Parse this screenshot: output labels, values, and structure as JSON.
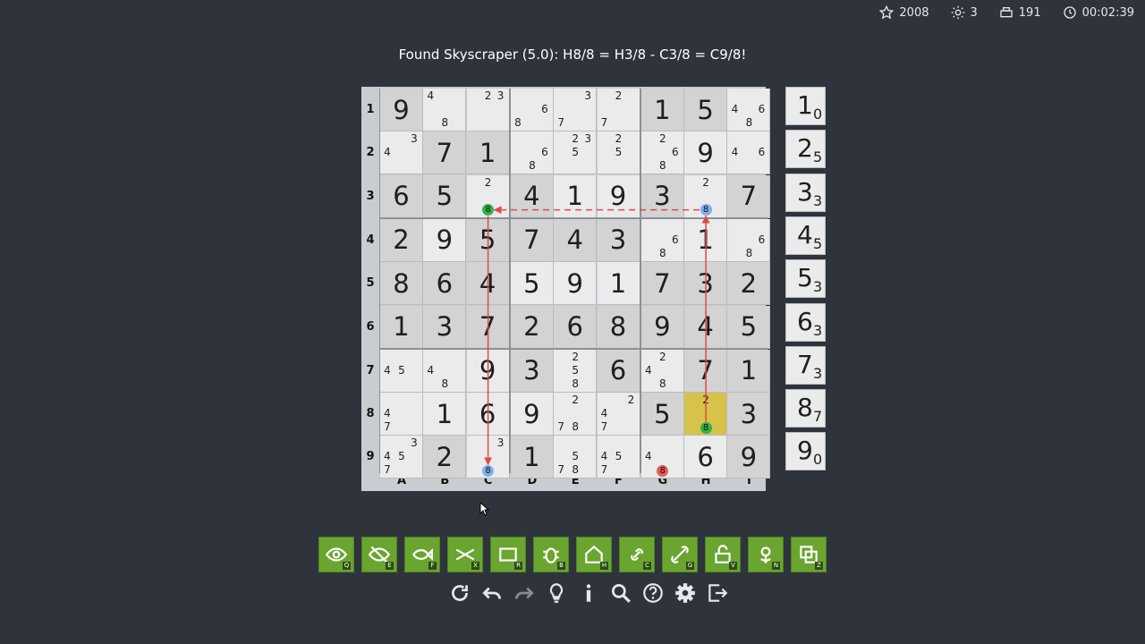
{
  "stats": {
    "stars": "2008",
    "hints": "3",
    "prints": "191",
    "timer": "00:02:39"
  },
  "message": "Found Skyscraper (5.0): H8/8 = H3/8 - C3/8 = C9/8!",
  "row_labels": [
    "1",
    "2",
    "3",
    "4",
    "5",
    "6",
    "7",
    "8",
    "9"
  ],
  "col_labels": [
    "A",
    "B",
    "C",
    "D",
    "E",
    "F",
    "G",
    "H",
    "I"
  ],
  "grid": [
    [
      {
        "v": "9",
        "given": true
      },
      {
        "c": [
          "4",
          "8"
        ],
        "pos": [
          0,
          7
        ]
      },
      {
        "c": [
          "2",
          "3"
        ],
        "pos": [
          1,
          2
        ]
      },
      {
        "c": [
          "6",
          "8"
        ],
        "pos": [
          5,
          6
        ]
      },
      {
        "c": [
          "3",
          "7"
        ],
        "pos": [
          2,
          6
        ]
      },
      {
        "c": [
          "2",
          "7"
        ],
        "pos": [
          1,
          6
        ]
      },
      {
        "v": "1",
        "given": true
      },
      {
        "v": "5",
        "given": true
      },
      {
        "c": [
          "4",
          "6",
          "8"
        ],
        "pos": [
          3,
          5,
          7
        ]
      }
    ],
    [
      {
        "c": [
          "4",
          "3"
        ],
        "pos": [
          3,
          2
        ]
      },
      {
        "v": "7",
        "given": true
      },
      {
        "v": "1",
        "given": true
      },
      {
        "c": [
          "6",
          "8"
        ],
        "pos": [
          5,
          7
        ]
      },
      {
        "c": [
          "2",
          "3",
          "5"
        ],
        "pos": [
          1,
          2,
          4
        ]
      },
      {
        "c": [
          "2",
          "5"
        ],
        "pos": [
          1,
          4
        ]
      },
      {
        "c": [
          "2",
          "6",
          "8"
        ],
        "pos": [
          1,
          5,
          7
        ]
      },
      {
        "v": "9",
        "given": false
      },
      {
        "c": [
          "4",
          "6"
        ],
        "pos": [
          3,
          5
        ]
      }
    ],
    [
      {
        "v": "6",
        "given": true
      },
      {
        "v": "5",
        "given": true
      },
      {
        "c": [
          "2",
          "8"
        ],
        "pos": [
          1,
          7
        ]
      },
      {
        "v": "4",
        "given": true
      },
      {
        "v": "1",
        "given": false
      },
      {
        "v": "9",
        "given": false
      },
      {
        "v": "3",
        "given": true
      },
      {
        "c": [
          "2",
          "8"
        ],
        "pos": [
          1,
          7
        ]
      },
      {
        "v": "7",
        "given": true
      }
    ],
    [
      {
        "v": "2",
        "given": true
      },
      {
        "v": "9",
        "given": false
      },
      {
        "v": "5",
        "given": true
      },
      {
        "v": "7",
        "given": true
      },
      {
        "v": "4",
        "given": true
      },
      {
        "v": "3",
        "given": true
      },
      {
        "c": [
          "6",
          "8"
        ],
        "pos": [
          5,
          7
        ]
      },
      {
        "v": "1",
        "given": false
      },
      {
        "c": [
          "6",
          "8"
        ],
        "pos": [
          5,
          7
        ]
      }
    ],
    [
      {
        "v": "8",
        "given": true
      },
      {
        "v": "6",
        "given": true
      },
      {
        "v": "4",
        "given": true
      },
      {
        "v": "5",
        "given": false
      },
      {
        "v": "9",
        "given": false
      },
      {
        "v": "1",
        "given": false
      },
      {
        "v": "7",
        "given": true
      },
      {
        "v": "3",
        "given": true
      },
      {
        "v": "2",
        "given": true
      }
    ],
    [
      {
        "v": "1",
        "given": true
      },
      {
        "v": "3",
        "given": true
      },
      {
        "v": "7",
        "given": true
      },
      {
        "v": "2",
        "given": true
      },
      {
        "v": "6",
        "given": true
      },
      {
        "v": "8",
        "given": true
      },
      {
        "v": "9",
        "given": true
      },
      {
        "v": "4",
        "given": true
      },
      {
        "v": "5",
        "given": true
      }
    ],
    [
      {
        "c": [
          "4",
          "5"
        ],
        "pos": [
          3,
          4
        ]
      },
      {
        "c": [
          "4",
          "8"
        ],
        "pos": [
          3,
          7
        ]
      },
      {
        "v": "9",
        "given": false
      },
      {
        "v": "3",
        "given": true
      },
      {
        "c": [
          "2",
          "5",
          "8"
        ],
        "pos": [
          1,
          4,
          7
        ]
      },
      {
        "v": "6",
        "given": true
      },
      {
        "c": [
          "2",
          "4",
          "8"
        ],
        "pos": [
          1,
          3,
          7
        ]
      },
      {
        "v": "7",
        "given": true
      },
      {
        "v": "1",
        "given": true
      }
    ],
    [
      {
        "c": [
          "4",
          "7"
        ],
        "pos": [
          3,
          6
        ]
      },
      {
        "v": "1",
        "given": false
      },
      {
        "v": "6",
        "given": false
      },
      {
        "v": "9",
        "given": false
      },
      {
        "c": [
          "2",
          "7",
          "8"
        ],
        "pos": [
          1,
          6,
          7
        ]
      },
      {
        "c": [
          "2",
          "4",
          "7"
        ],
        "pos": [
          2,
          3,
          6
        ]
      },
      {
        "v": "5",
        "given": true
      },
      {
        "c": [
          "2",
          "8"
        ],
        "pos": [
          1,
          7
        ],
        "highlight": true
      },
      {
        "v": "3",
        "given": true
      }
    ],
    [
      {
        "c": [
          "3",
          "4",
          "5",
          "7"
        ],
        "pos": [
          2,
          3,
          4,
          6
        ]
      },
      {
        "v": "2",
        "given": true
      },
      {
        "c": [
          "3",
          "8"
        ],
        "pos": [
          2,
          7
        ]
      },
      {
        "v": "1",
        "given": true
      },
      {
        "c": [
          "5",
          "7",
          "8"
        ],
        "pos": [
          4,
          6,
          7
        ]
      },
      {
        "c": [
          "4",
          "5",
          "7"
        ],
        "pos": [
          3,
          4,
          6
        ]
      },
      {
        "c": [
          "4",
          "8"
        ],
        "pos": [
          3,
          7
        ]
      },
      {
        "v": "6",
        "given": false
      },
      {
        "v": "9",
        "given": true
      }
    ]
  ],
  "markers": [
    {
      "name": "marker-c3-8",
      "row": 2,
      "col": 2,
      "pos": 7,
      "digit": "8",
      "color": "green"
    },
    {
      "name": "marker-h3-8",
      "row": 2,
      "col": 7,
      "pos": 7,
      "digit": "8",
      "color": "blue"
    },
    {
      "name": "marker-c9-8",
      "row": 8,
      "col": 2,
      "pos": 7,
      "digit": "8",
      "color": "blue"
    },
    {
      "name": "marker-h8-8",
      "row": 7,
      "col": 7,
      "pos": 7,
      "digit": "8",
      "color": "green"
    },
    {
      "name": "marker-g9-8",
      "row": 8,
      "col": 6,
      "pos": 7,
      "digit": "8",
      "color": "red"
    }
  ],
  "links": [
    {
      "name": "link-h3-c3",
      "from": {
        "row": 2,
        "col": 7
      },
      "to": {
        "row": 2,
        "col": 2
      },
      "style": "dashed"
    },
    {
      "name": "link-c3-c9",
      "from": {
        "row": 2,
        "col": 2
      },
      "to": {
        "row": 8,
        "col": 2
      },
      "style": "solid"
    },
    {
      "name": "link-h8-h3",
      "from": {
        "row": 7,
        "col": 7
      },
      "to": {
        "row": 2,
        "col": 7
      },
      "style": "solid"
    }
  ],
  "number_counts": [
    {
      "digit": "1",
      "count": "0"
    },
    {
      "digit": "2",
      "count": "5"
    },
    {
      "digit": "3",
      "count": "3"
    },
    {
      "digit": "4",
      "count": "5"
    },
    {
      "digit": "5",
      "count": "3"
    },
    {
      "digit": "6",
      "count": "3"
    },
    {
      "digit": "7",
      "count": "3"
    },
    {
      "digit": "8",
      "count": "7"
    },
    {
      "digit": "9",
      "count": "0"
    }
  ],
  "tools": [
    {
      "name": "eye",
      "key": "Q"
    },
    {
      "name": "eye-slash",
      "key": "E"
    },
    {
      "name": "fish",
      "key": "F"
    },
    {
      "name": "x-wing",
      "key": "X"
    },
    {
      "name": "rectangle",
      "key": "R"
    },
    {
      "name": "bug",
      "key": "B"
    },
    {
      "name": "house",
      "key": "H"
    },
    {
      "name": "chain",
      "key": "C"
    },
    {
      "name": "group-chain",
      "key": "G"
    },
    {
      "name": "unlock",
      "key": "V"
    },
    {
      "name": "flower",
      "key": "N"
    },
    {
      "name": "copy",
      "key": "Z"
    }
  ],
  "actions": [
    "restart",
    "undo",
    "redo",
    "hint",
    "info",
    "search",
    "help",
    "settings",
    "exit"
  ],
  "colors": {
    "accent_green": "#6aa52f",
    "highlight": "#d7c24a",
    "link_red": "#e04848",
    "marker_green": "#33b34a",
    "marker_blue": "#7fb0ef",
    "marker_red": "#e55b5b"
  }
}
